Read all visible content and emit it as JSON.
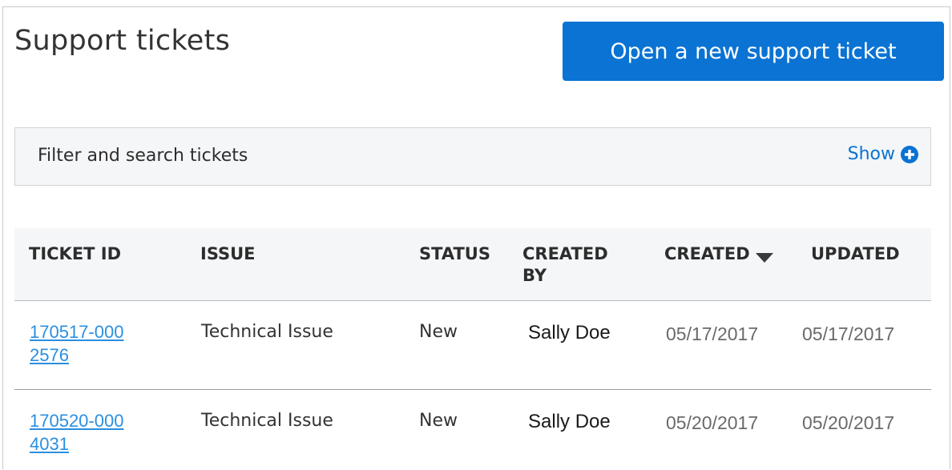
{
  "page": {
    "title": "Support tickets"
  },
  "actions": {
    "new_ticket_label": "Open a new support ticket"
  },
  "filter": {
    "label": "Filter and search tickets",
    "toggle_label": "Show",
    "toggle_icon": "plus-circle-icon"
  },
  "table": {
    "columns": {
      "ticket_id": "TICKET ID",
      "issue": "ISSUE",
      "status": "STATUS",
      "created_by": "CREATED BY",
      "created": "CREATED",
      "updated": "UPDATED"
    },
    "sort": {
      "column": "CREATED",
      "direction": "descending",
      "icon": "sort-down-icon"
    },
    "rows": [
      {
        "ticket_id": "170517-0002576",
        "issue": "Technical Issue",
        "status": "New",
        "created_by": "Sally Doe",
        "created": "05/17/2017",
        "updated": "05/17/2017"
      },
      {
        "ticket_id": "170520-0004031",
        "issue": "Technical Issue",
        "status": "New",
        "created_by": "Sally Doe",
        "created": "05/20/2017",
        "updated": "05/20/2017"
      }
    ]
  },
  "colors": {
    "accent": "#0a73d3",
    "link": "#2a8fe0",
    "header_bg": "#f4f6f8"
  }
}
